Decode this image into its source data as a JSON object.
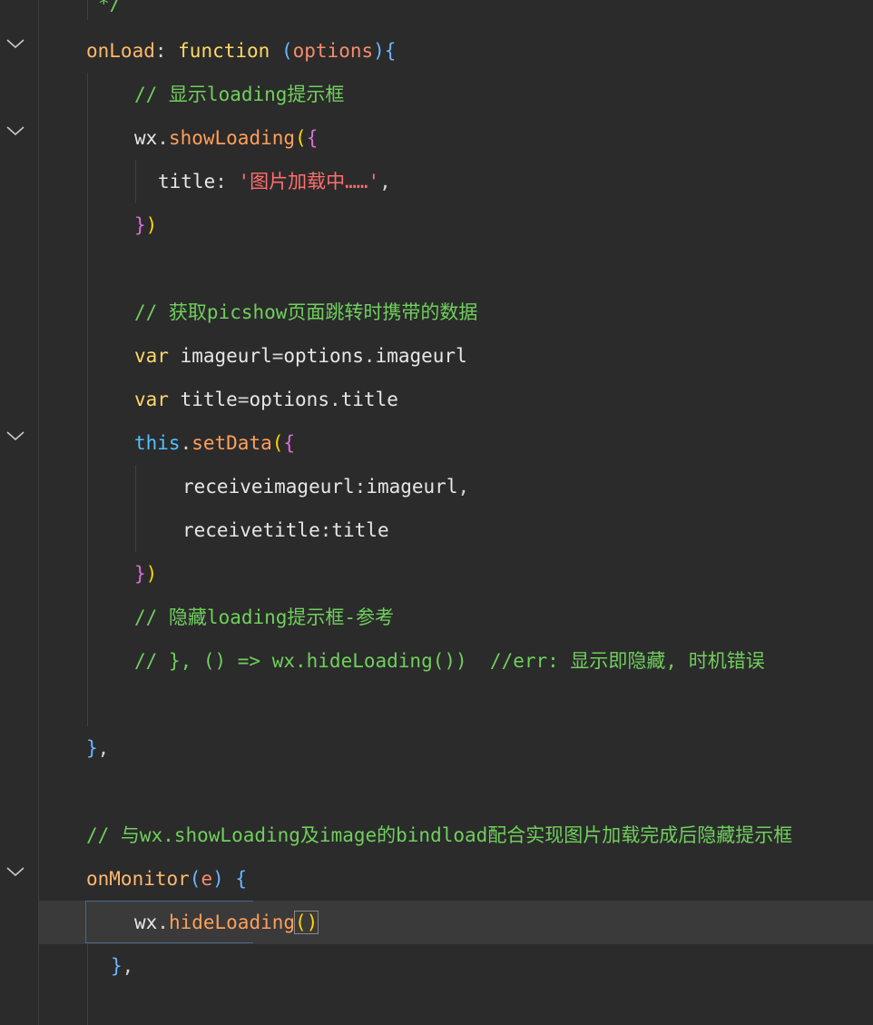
{
  "editor": {
    "lines": [
      {
        "id": "l0",
        "tokens": [
          [
            "comment",
            "*/"
          ]
        ]
      },
      {
        "id": "l1",
        "tokens": [
          [
            "fn",
            "onLoad"
          ],
          [
            "punc",
            ": "
          ],
          [
            "kw",
            "function"
          ],
          [
            "punc",
            " "
          ],
          [
            "brace-b",
            "("
          ],
          [
            "param",
            "options"
          ],
          [
            "brace-b",
            ")"
          ],
          [
            "brace-b",
            "{"
          ]
        ]
      },
      {
        "id": "l2",
        "tokens": [
          [
            "comment",
            "// 显示loading提示框"
          ]
        ]
      },
      {
        "id": "l3",
        "tokens": [
          [
            "prop",
            "wx"
          ],
          [
            "punc",
            "."
          ],
          [
            "method",
            "showLoading"
          ],
          [
            "brace-y",
            "("
          ],
          [
            "brace-p",
            "{"
          ]
        ]
      },
      {
        "id": "l4",
        "tokens": [
          [
            "prop",
            "title"
          ],
          [
            "punc",
            ": "
          ],
          [
            "str",
            "'图片加载中……'"
          ],
          [
            "punc",
            ","
          ]
        ]
      },
      {
        "id": "l5",
        "tokens": [
          [
            "brace-p",
            "}"
          ],
          [
            "brace-y",
            ")"
          ]
        ]
      },
      {
        "id": "l6",
        "tokens": []
      },
      {
        "id": "l7",
        "tokens": [
          [
            "comment",
            "// 获取picshow页面跳转时携带的数据"
          ]
        ]
      },
      {
        "id": "l8",
        "tokens": [
          [
            "kw",
            "var"
          ],
          [
            "punc",
            " "
          ],
          [
            "prop",
            "imageurl"
          ],
          [
            "punc",
            "="
          ],
          [
            "prop",
            "options"
          ],
          [
            "punc",
            "."
          ],
          [
            "prop",
            "imageurl"
          ]
        ]
      },
      {
        "id": "l9",
        "tokens": [
          [
            "kw",
            "var"
          ],
          [
            "punc",
            " "
          ],
          [
            "prop",
            "title"
          ],
          [
            "punc",
            "="
          ],
          [
            "prop",
            "options"
          ],
          [
            "punc",
            "."
          ],
          [
            "prop",
            "title"
          ]
        ]
      },
      {
        "id": "l10",
        "tokens": [
          [
            "this",
            "this"
          ],
          [
            "punc",
            "."
          ],
          [
            "method",
            "setData"
          ],
          [
            "brace-y",
            "("
          ],
          [
            "brace-p",
            "{"
          ]
        ]
      },
      {
        "id": "l11",
        "tokens": [
          [
            "prop",
            "receiveimageurl"
          ],
          [
            "punc",
            ":"
          ],
          [
            "prop",
            "imageurl"
          ],
          [
            "punc",
            ","
          ]
        ]
      },
      {
        "id": "l12",
        "tokens": [
          [
            "prop",
            "receivetitle"
          ],
          [
            "punc",
            ":"
          ],
          [
            "prop",
            "title"
          ]
        ]
      },
      {
        "id": "l13",
        "tokens": [
          [
            "brace-p",
            "}"
          ],
          [
            "brace-y",
            ")"
          ]
        ]
      },
      {
        "id": "l14",
        "tokens": [
          [
            "comment",
            "// 隐藏loading提示框-参考"
          ]
        ]
      },
      {
        "id": "l15",
        "tokens": [
          [
            "comment",
            "// }, () => wx.hideLoading())  //err: 显示即隐藏, 时机错误"
          ]
        ]
      },
      {
        "id": "l16",
        "tokens": []
      },
      {
        "id": "l17",
        "tokens": [
          [
            "brace-b",
            "}"
          ],
          [
            "punc",
            ","
          ]
        ]
      },
      {
        "id": "l18",
        "tokens": []
      },
      {
        "id": "l19",
        "tokens": [
          [
            "comment",
            "// 与wx.showLoading及image的bindload配合实现图片加载完成后隐藏提示框"
          ]
        ]
      },
      {
        "id": "l20",
        "tokens": [
          [
            "fn",
            "onMonitor"
          ],
          [
            "brace-b",
            "("
          ],
          [
            "param",
            "e"
          ],
          [
            "brace-b",
            ")"
          ],
          [
            "punc",
            " "
          ],
          [
            "brace-b",
            "{"
          ]
        ]
      },
      {
        "id": "l21",
        "tokens": [
          [
            "prop",
            "wx"
          ],
          [
            "punc",
            "."
          ],
          [
            "method",
            "hideLoading"
          ],
          [
            "brace-y",
            "()"
          ]
        ]
      },
      {
        "id": "l22",
        "tokens": [
          [
            "brace-b",
            "}"
          ],
          [
            "punc",
            ","
          ]
        ]
      }
    ],
    "fold_icons": [
      "chevron-down",
      "chevron-down",
      "chevron-down",
      "chevron-down",
      "chevron-down"
    ]
  },
  "colors": {
    "background": "#2b2b2b",
    "comment": "#6fcf5c",
    "keyword": "#ffd866",
    "string": "#ff6e6e",
    "this": "#4fc1ff"
  }
}
